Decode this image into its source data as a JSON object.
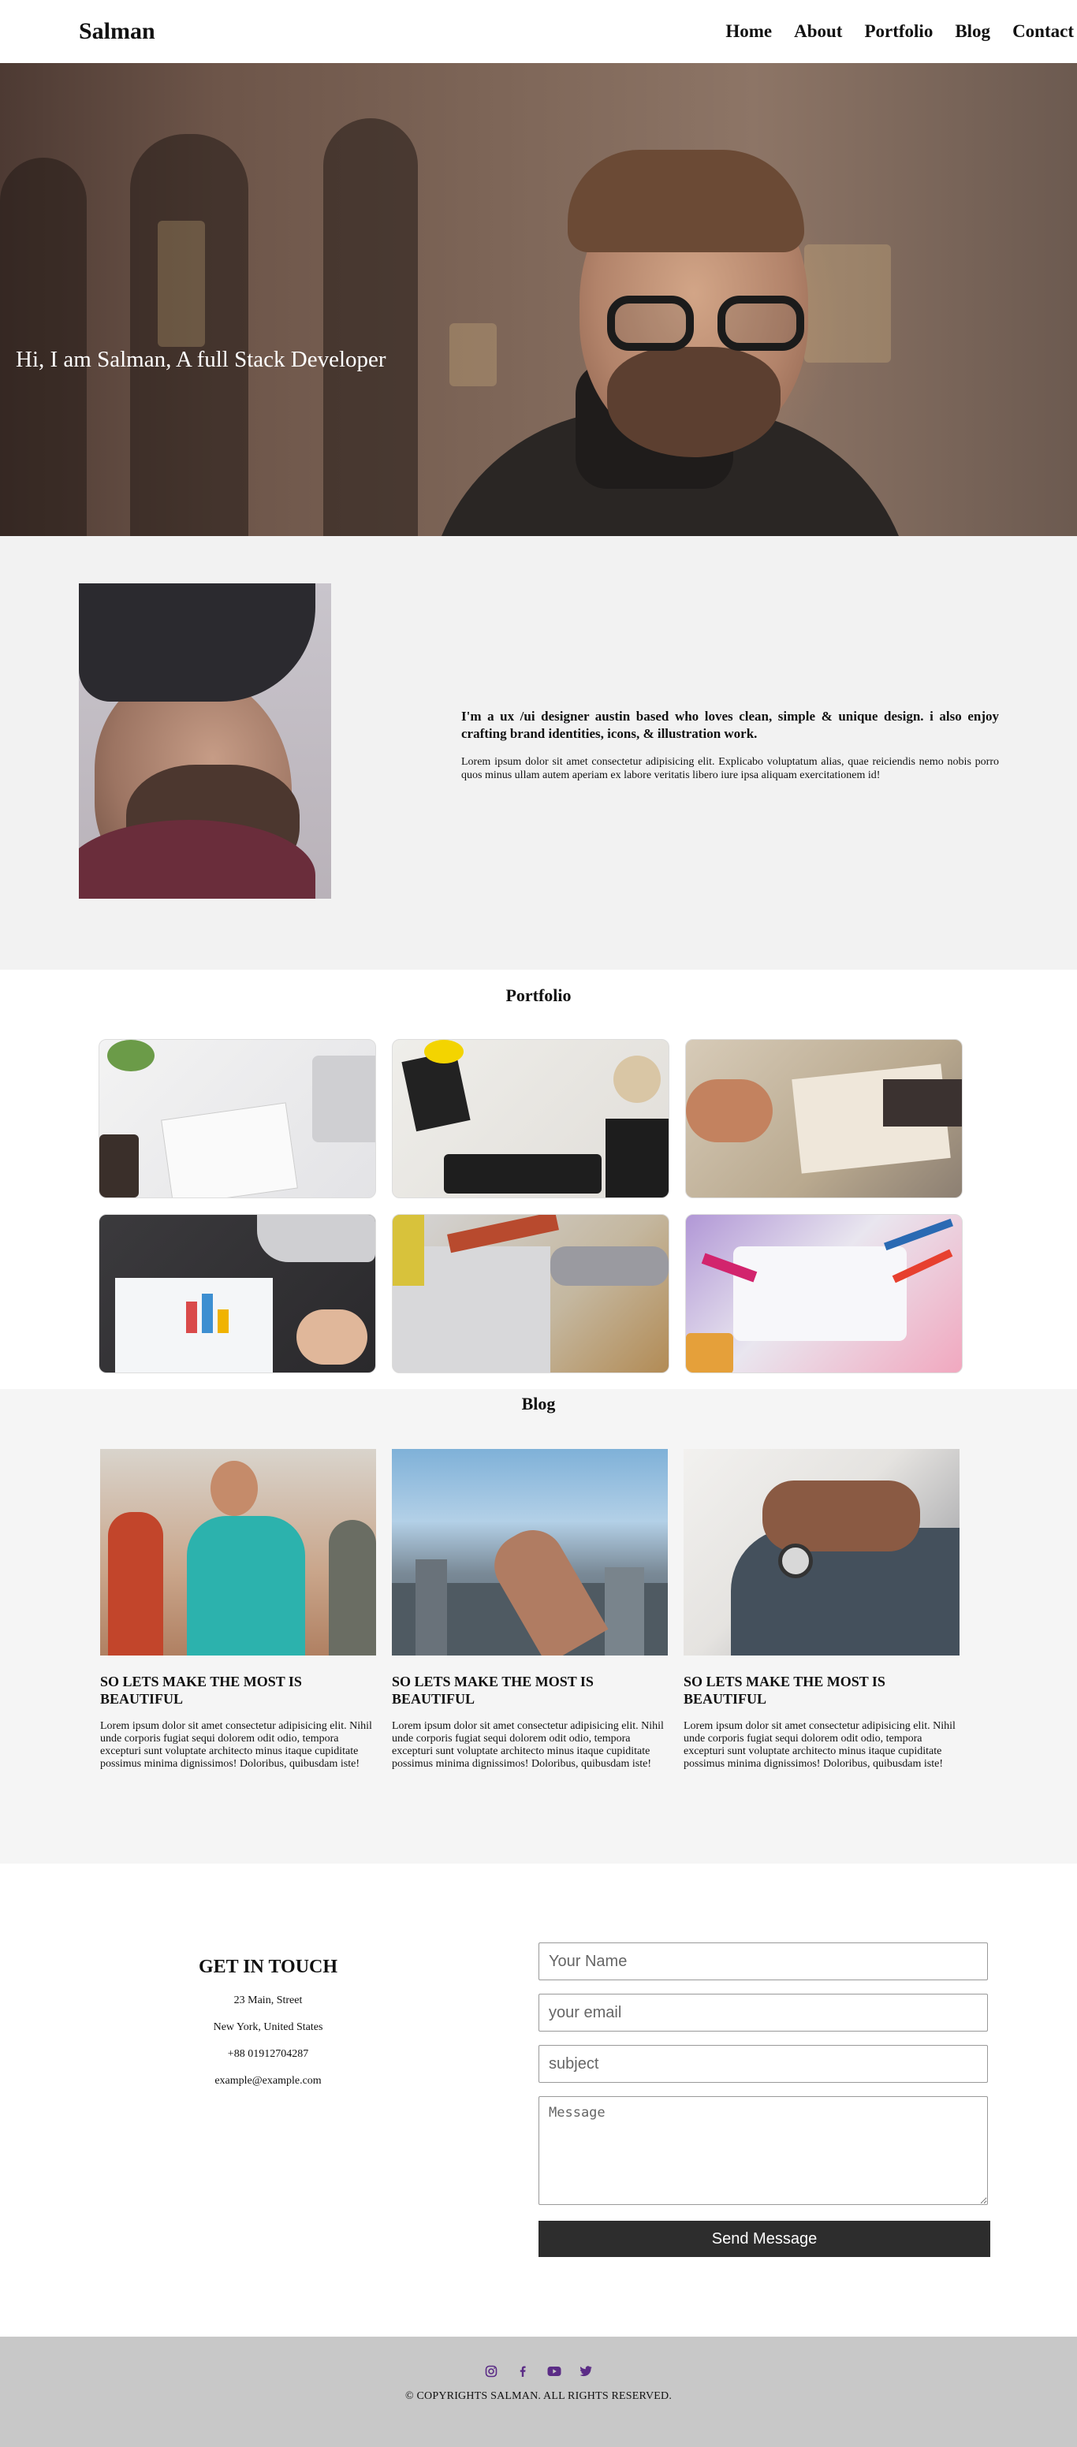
{
  "header": {
    "brand": "Salman",
    "nav": [
      "Home",
      "About",
      "Portfolio",
      "Blog",
      "Contact"
    ]
  },
  "hero": {
    "title": "Hi, I am Salman, A full Stack Developer"
  },
  "about": {
    "heading": "I'm a ux /ui designer austin based who loves clean, simple & unique design. i also enjoy crafting brand identities, icons, & illustration work.",
    "body": "Lorem ipsum dolor sit amet consectetur adipisicing elit. Explicabo voluptatum alias, quae reiciendis nemo nobis porro quos minus ullam autem aperiam ex labore veritatis libero iure ipsa aliquam exercitationem id!"
  },
  "portfolio": {
    "title": "Portfolio",
    "items": [
      "notebook-desk",
      "keyboard-creative-mess",
      "design-sketching",
      "chart-report",
      "blueprint-tools",
      "art-supplies"
    ]
  },
  "blog": {
    "title": "Blog",
    "posts": [
      {
        "title": "SO LETS MAKE THE MOST IS BEAUTIFUL",
        "body": "Lorem ipsum dolor sit amet consectetur adipisicing elit. Nihil unde corporis fugiat sequi dolorem odit odio, tempora excepturi sunt voluptate architecto minus itaque cupiditate possimus minima dignissimos! Doloribus, quibusdam iste!"
      },
      {
        "title": "SO LETS MAKE THE MOST IS BEAUTIFUL",
        "body": "Lorem ipsum dolor sit amet consectetur adipisicing elit. Nihil unde corporis fugiat sequi dolorem odit odio, tempora excepturi sunt voluptate architecto minus itaque cupiditate possimus minima dignissimos! Doloribus, quibusdam iste!"
      },
      {
        "title": "SO LETS MAKE THE MOST IS BEAUTIFUL",
        "body": "Lorem ipsum dolor sit amet consectetur adipisicing elit. Nihil unde corporis fugiat sequi dolorem odit odio, tempora excepturi sunt voluptate architecto minus itaque cupiditate possimus minima dignissimos! Doloribus, quibusdam iste!"
      }
    ]
  },
  "contact": {
    "title": "GET IN TOUCH",
    "address_line1": "23 Main, Street",
    "address_line2": "New York, United States",
    "phone": "+88 01912704287",
    "email": "example@example.com",
    "form": {
      "name_placeholder": "Your Name",
      "email_placeholder": "your email",
      "subject_placeholder": "subject",
      "message_placeholder": "Message",
      "submit_label": "Send Message"
    }
  },
  "footer": {
    "social_icons": [
      "instagram-icon",
      "facebook-icon",
      "youtube-icon",
      "twitter-icon"
    ],
    "accent_color": "#5b2c86",
    "copyright": "© COPYRIGHTS SALMAN. ALL RIGHTS RESERVED."
  }
}
